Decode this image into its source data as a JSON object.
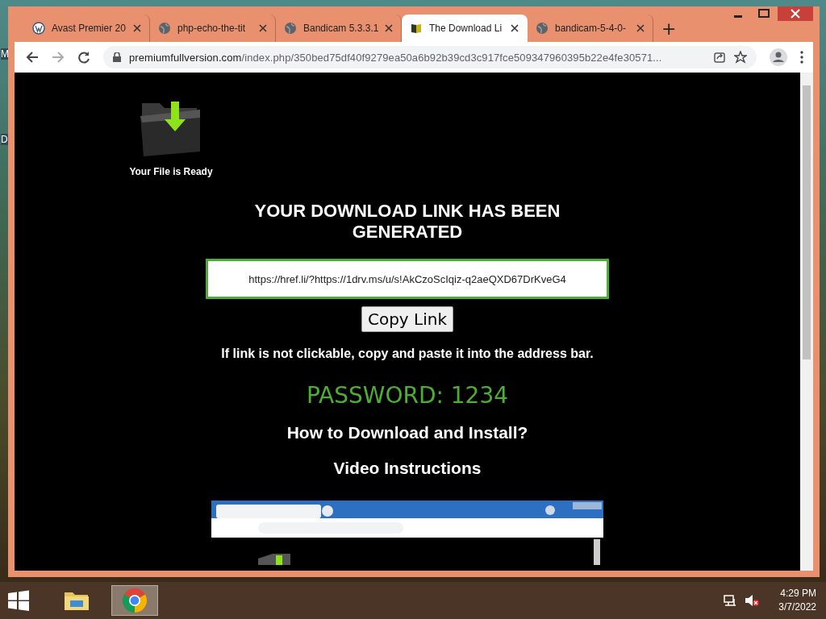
{
  "desktop": {
    "icon_labels": [
      "M",
      "D"
    ]
  },
  "browser": {
    "tabs": [
      {
        "title": "Avast Premier 20",
        "kind": "wordpress",
        "selected": false
      },
      {
        "title": "php-echo-the-tit",
        "kind": "globe",
        "selected": false
      },
      {
        "title": "Bandicam 5.3.3.1",
        "kind": "globe",
        "selected": false
      },
      {
        "title": "The Download Li",
        "kind": "book",
        "selected": true
      },
      {
        "title": "bandicam-5-4-0-",
        "kind": "globe",
        "selected": false
      }
    ],
    "new_tab": "+",
    "address": {
      "host": "premiumfullversion.com",
      "path": "/index.php/350bed75df40f9279ea50a6b92b39cd3c917fce509347960395b22e4fe30571..."
    },
    "page": {
      "caption": "Your File is Ready",
      "heading": "YOUR DOWNLOAD LINK HAS BEEN GENERATED",
      "link": "https://href.li/?https://1drv.ms/u/s!AkCzoScIqiz-q2aeQXD67DrKveG4",
      "copy_button": "Copy Link",
      "note": "If link is not clickable, copy and paste it into the address bar.",
      "password": "PASSWORD: 1234",
      "how_to": "How to Download and Install?",
      "video_title": "Video Instructions"
    }
  },
  "taskbar": {
    "apps": [
      {
        "kind": "explorer",
        "selected": false
      },
      {
        "kind": "chrome",
        "selected": true
      }
    ],
    "time": "4:29 PM",
    "date": "3/7/2022"
  }
}
